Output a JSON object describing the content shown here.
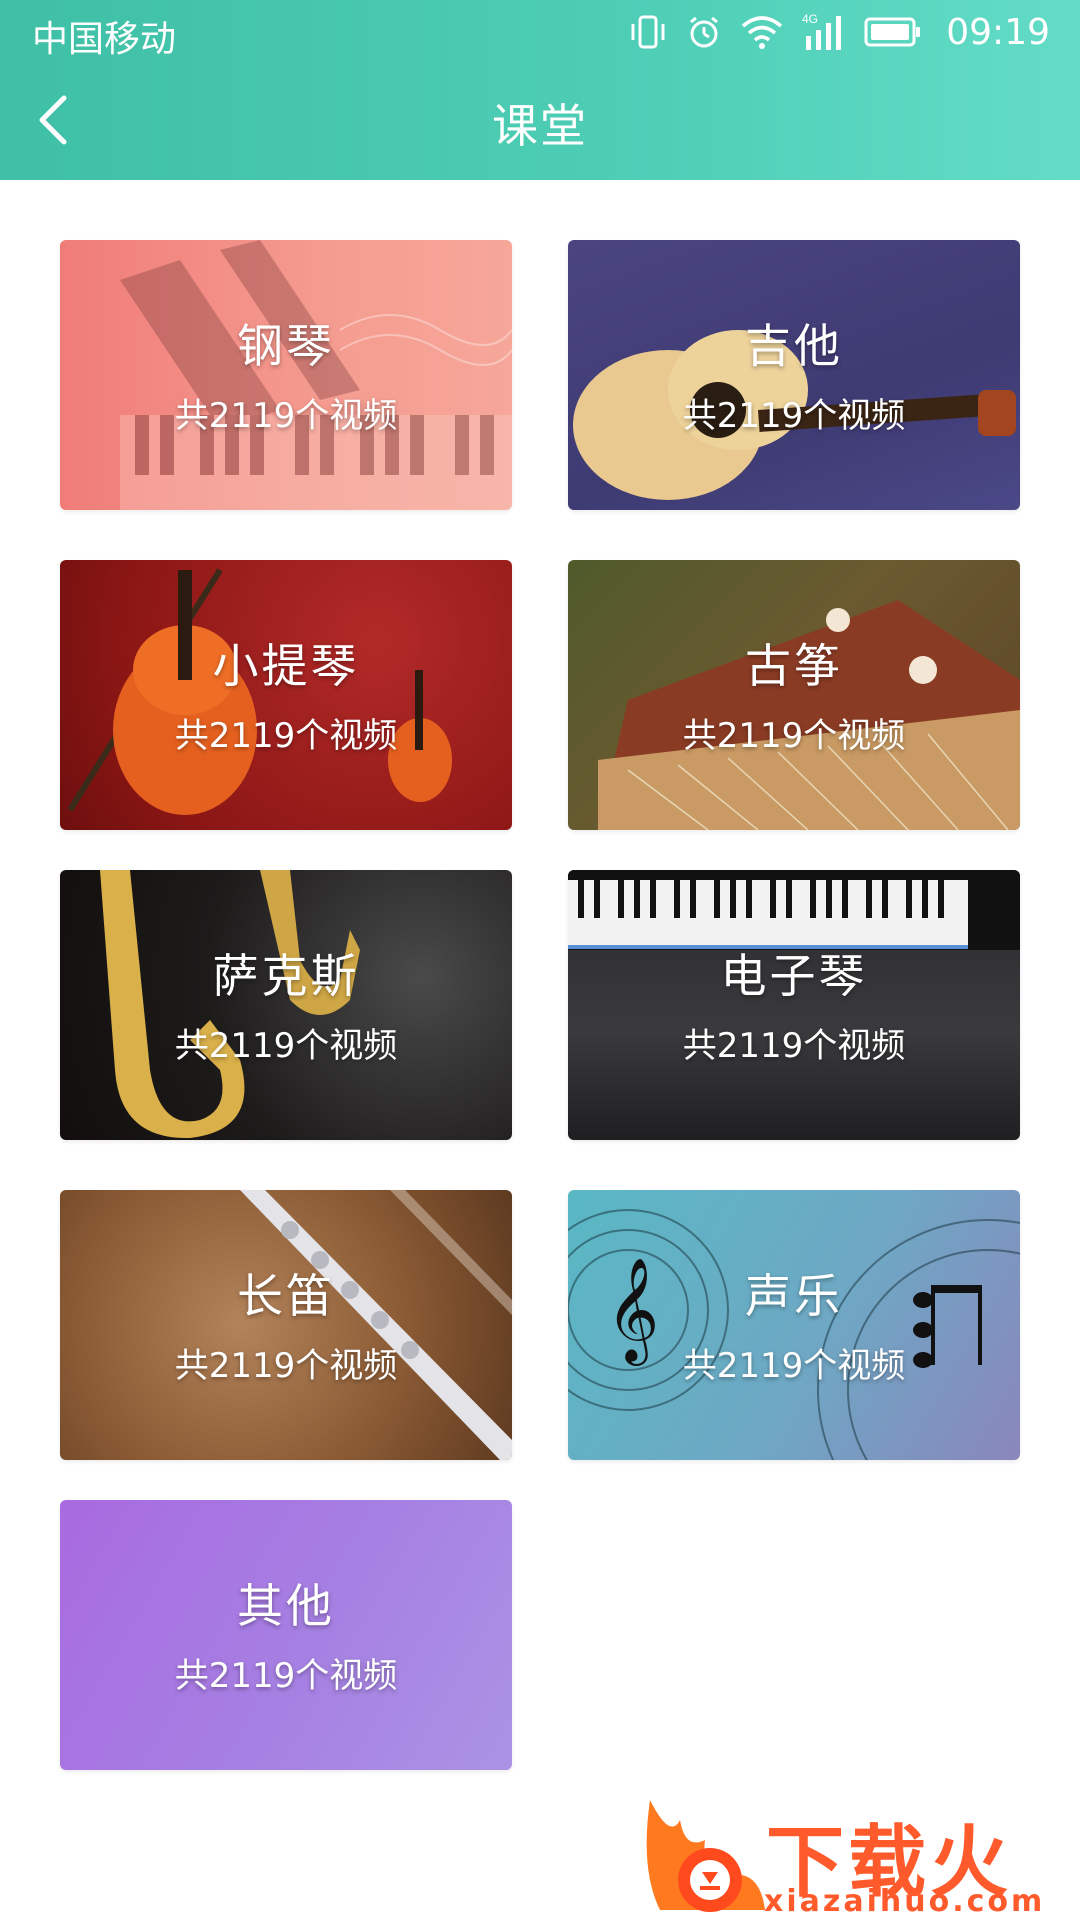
{
  "status_bar": {
    "carrier": "中国移动",
    "network": "4G",
    "time": "09:19"
  },
  "header": {
    "title": "课堂",
    "back_icon": "chevron-left-icon",
    "background_colors": [
      "#3fc0a6",
      "#63dcc7"
    ]
  },
  "categories": [
    {
      "name": "钢琴",
      "count": "共2119个视频"
    },
    {
      "name": "吉他",
      "count": "共2119个视频"
    },
    {
      "name": "小提琴",
      "count": "共2119个视频"
    },
    {
      "name": "古筝",
      "count": "共2119个视频"
    },
    {
      "name": "萨克斯",
      "count": "共2119个视频"
    },
    {
      "name": "电子琴",
      "count": "共2119个视频"
    },
    {
      "name": "长笛",
      "count": "共2119个视频"
    },
    {
      "name": "声乐",
      "count": "共2119个视频"
    },
    {
      "name": "其他",
      "count": "共2119个视频"
    }
  ],
  "watermark": {
    "text": "下载火",
    "url": "xiazaihuo.com",
    "color": "#ff5a2b"
  }
}
